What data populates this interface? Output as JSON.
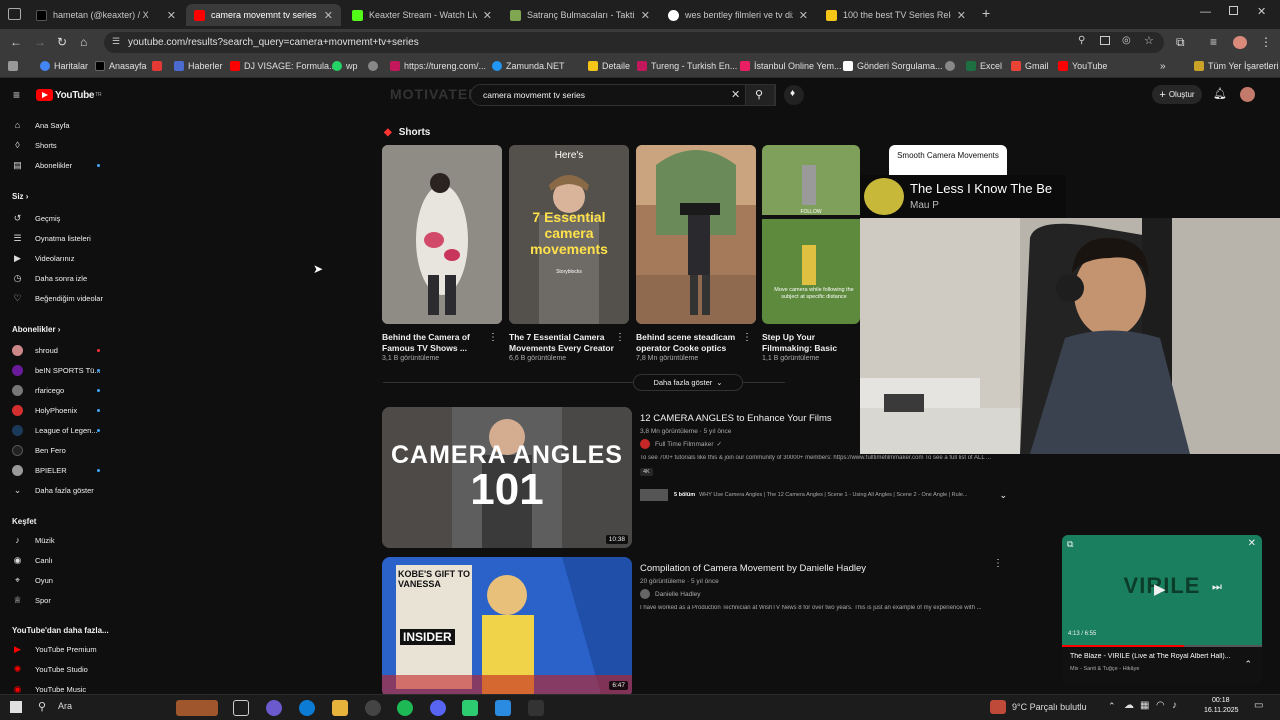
{
  "tabs": [
    {
      "label": "hametan (@keaxter) / X",
      "color": "#000000"
    },
    {
      "label": "camera movemnt tv series - Yo",
      "color": "#ff0000"
    },
    {
      "label": "Keaxter Stream - Watch Live on",
      "color": "#53fc18"
    },
    {
      "label": "Satranç Bulmacaları - Taktik Ha",
      "color": "#7fa650"
    },
    {
      "label": "wes bentley filmleri ve tv dizile",
      "color": "#4285f4"
    },
    {
      "label": "100 the best TV Series Release",
      "color": "#f5c518"
    }
  ],
  "address": {
    "url": "youtube.com/results?search_query=camera+movmemt+tv+series"
  },
  "bookmarks": [
    "Haritalar",
    "Anasayfa",
    "Haberler",
    "DJ VISAGE: Formula...",
    "wp",
    "",
    "https://tureng.com/...",
    "Zamunda.NET",
    "Detaile",
    "Tureng - Turkish En...",
    "İstanbul Online Yem...",
    "Gönderi Sorgulama...",
    "Excel",
    "Gmail",
    "YouTube"
  ],
  "bookmarks_other": "Tüm Yer İşaretleri",
  "youtube": {
    "logo": "YouTube",
    "logo_sup": "TR",
    "search_value": "camera movmemt tv series",
    "create_label": "Oluştur",
    "banner_text": "MOTIVATED CA",
    "sidebar": {
      "main": [
        "Ana Sayfa",
        "Shorts",
        "Abonelikler"
      ],
      "you_header": "Siz",
      "you": [
        "Geçmiş",
        "Oynatma listeleri",
        "Videolarınız",
        "Daha sonra izle",
        "Beğendiğim videolar"
      ],
      "subs_header": "Abonelikler",
      "subs": [
        "shroud",
        "beIN SPORTS Tü...",
        "rfaricego",
        "HolyPhoenix",
        "League of Legen...",
        "Ben Fero",
        "BPIELER",
        "Daha fazla göster"
      ],
      "explore_header": "Keşfet",
      "explore": [
        "Müzik",
        "Canlı",
        "Oyun",
        "Spor"
      ],
      "more_header": "YouTube'dan daha fazla...",
      "more": [
        "YouTube Premium",
        "YouTube Studio",
        "YouTube Music"
      ]
    },
    "shorts_header": "Shorts",
    "shorts": [
      {
        "title": "Behind the Camera of Famous TV Shows ...",
        "views": "3,1 B görüntüleme"
      },
      {
        "title": "The 7 Essential Camera Movements Every Creator ...",
        "views": "6,6 B görüntüleme",
        "overlay_top": "Here's",
        "overlay_main": "7 Essential camera movements",
        "overlay_brand": "Storyblocks"
      },
      {
        "title": "Behind scene steadicam operator Cooke optics",
        "views": "7,8 Mn görüntüleme"
      },
      {
        "title": "Step Up Your Filmmaking: Basic Camera Movement ...",
        "views": "1,1 B görüntüleme",
        "overlay_follow": "FOLLOW",
        "overlay_caption": "Move camera while following the subject at specific distance"
      },
      {
        "title": "Smooth Camera Movements",
        "views": ""
      }
    ],
    "show_more": "Daha fazla göster",
    "videos": [
      {
        "title": "12 CAMERA ANGLES to Enhance Your Films",
        "meta": "3,8 Mn görüntüleme · 5 yıl önce",
        "channel": "Full Time Filmmaker",
        "desc": "To see 700+ tutorials like this & join our community of 30000+ members: https://www.fulltimefilmmaker.com To see a full list of ALL ...",
        "badge": "4K",
        "chapters_count": "5 bölüm",
        "chapters": "WHY Use Camera Angles | The 12 Camera Angles | Scene 1 - Using All Angles | Scene 2 - One Angle | Rule...",
        "thumb_text1": "CAMERA ANGLES",
        "thumb_text2": "101",
        "duration": "10:38"
      },
      {
        "title": "Compilation of Camera Movement by Danielle Hadley",
        "meta": "20 görüntüleme · 5 yıl önce",
        "channel": "Danielle Hadley",
        "desc": "I have worked as a Production Technician at WishTV News 8 for over two years. This is just an example of my experience with ...",
        "thumb_text": "KOBE'S GIFT TO VANESSA",
        "thumb_brand": "INSIDER",
        "duration": "6:47"
      }
    ],
    "popup": {
      "title": "The Less I Know The Be",
      "artist": "Mau P"
    },
    "miniplayer": {
      "thumb_text": "VIRILE",
      "time": "4:13 / 6:55",
      "title": "The Blaze - VIRILE (Live at The Royal Albert Hall)...",
      "sub": "Mix - Santi & Tuğçe - Hikâye",
      "progress": 0.61
    }
  },
  "taskbar": {
    "search": "Ara",
    "weather": "9°C  Parçalı bulutlu",
    "time": "00:18",
    "date": "16.11.2025"
  }
}
